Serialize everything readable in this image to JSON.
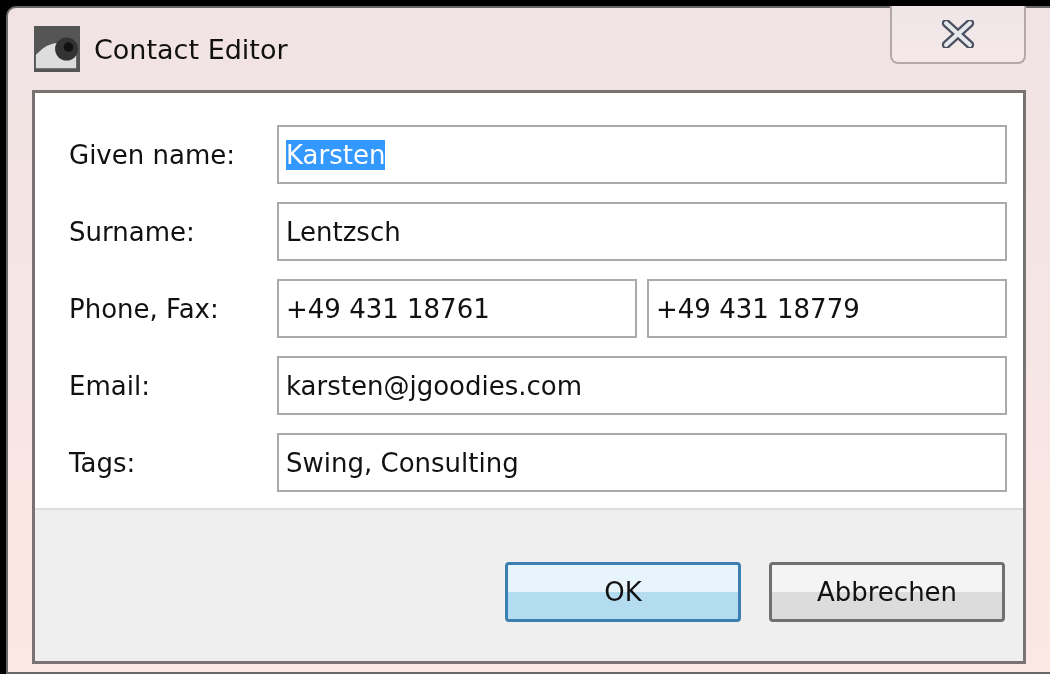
{
  "window": {
    "title": "Contact Editor"
  },
  "rows": [
    {
      "label": "Given name:",
      "fields": [
        {
          "value": "Karsten",
          "text_selected": true
        }
      ]
    },
    {
      "label": "Surname:",
      "fields": [
        {
          "value": "Lentzsch",
          "text_selected": false
        }
      ]
    },
    {
      "label": "Phone, Fax:",
      "fields": [
        {
          "value": "+49 431 18761",
          "text_selected": false
        },
        {
          "value": "+49 431 18779",
          "text_selected": false
        }
      ]
    },
    {
      "label": "Email:",
      "fields": [
        {
          "value": "karsten@jgoodies.com",
          "text_selected": false
        }
      ]
    },
    {
      "label": "Tags:",
      "fields": [
        {
          "value": "Swing, Consulting",
          "text_selected": false
        }
      ]
    }
  ],
  "buttons": [
    {
      "label": "OK",
      "default": true
    },
    {
      "label": "Abbrechen",
      "default": false
    }
  ]
}
